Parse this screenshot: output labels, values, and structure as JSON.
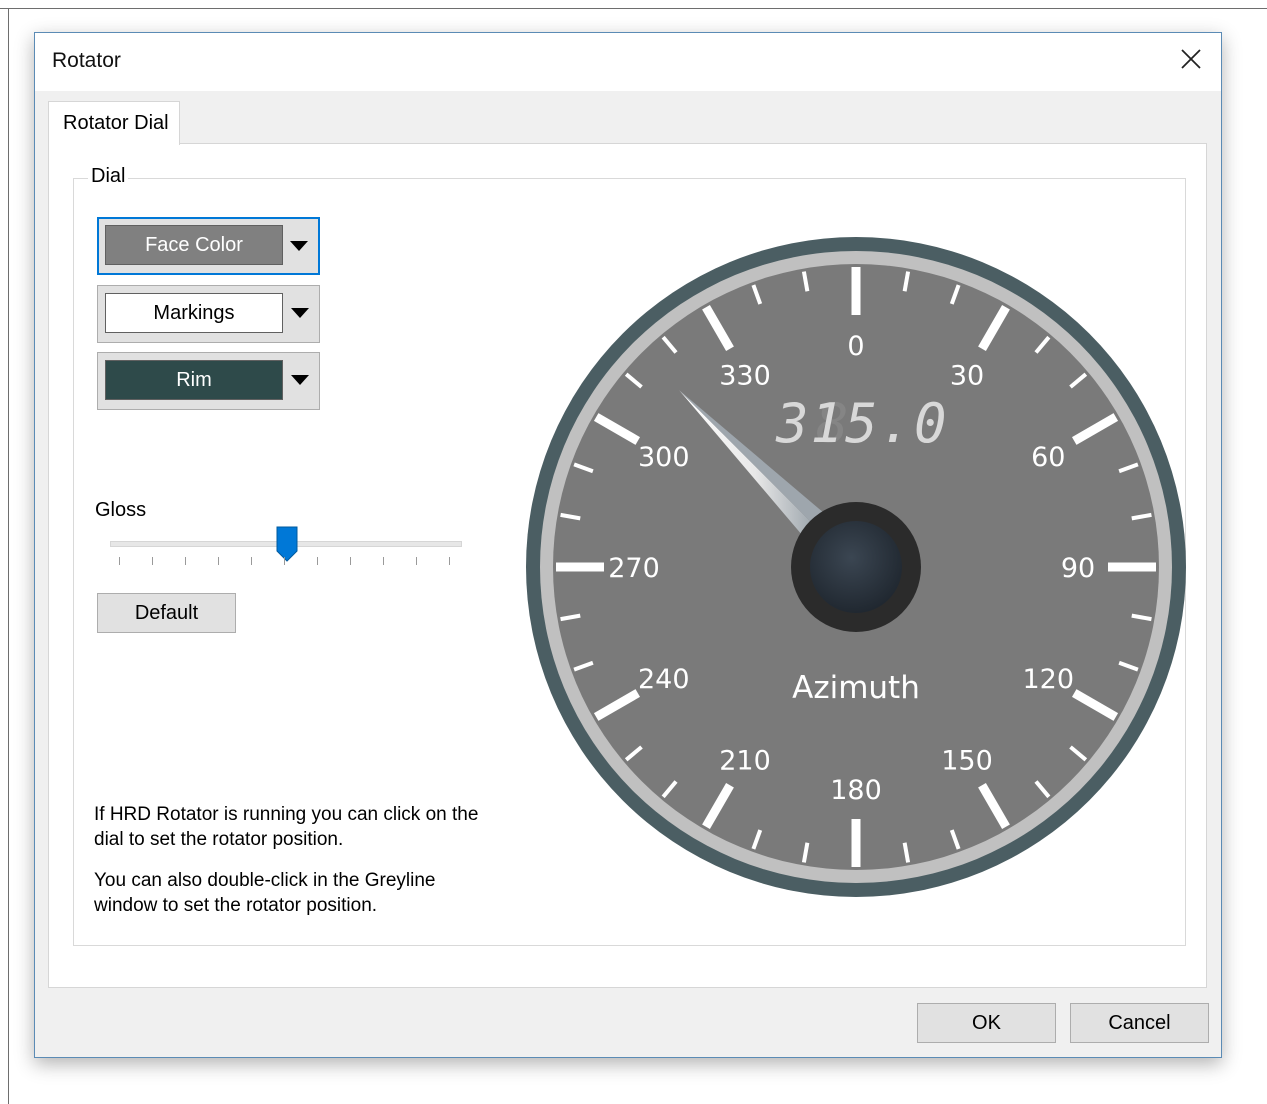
{
  "window": {
    "title": "Rotator",
    "close_icon": "close-icon"
  },
  "tabs": [
    {
      "label": "Rotator Dial",
      "active": true
    }
  ],
  "dial_group": {
    "label": "Dial",
    "face_color": {
      "label": "Face Color",
      "color": "#808080",
      "text_color": "#ffffff"
    },
    "markings": {
      "label": "Markings",
      "color": "#ffffff",
      "text_color": "#000000"
    },
    "rim": {
      "label": "Rim",
      "color": "#2e4a4a",
      "text_color": "#ffffff"
    },
    "gloss": {
      "label": "Gloss",
      "value": 0.5,
      "tick_count": 11
    },
    "default_button": "Default",
    "help_text_1": "If HRD Rotator is running you can click on the dial to set the rotator position.",
    "help_text_2": "You can also double-click in the Greyline window to set the rotator position."
  },
  "dial": {
    "digital_readout": "315.0",
    "digital_ghost": "8",
    "caption": "Azimuth",
    "heading_deg": 315,
    "scale_labels": [
      "0",
      "30",
      "60",
      "90",
      "120",
      "150",
      "180",
      "210",
      "240",
      "270",
      "300",
      "330"
    ],
    "colors": {
      "face": "#7a7a7a",
      "rim": "#4b5e63",
      "ring": "#c0c0c0",
      "markings": "#ffffff",
      "hub": "#222830"
    }
  },
  "footer": {
    "ok_label": "OK",
    "cancel_label": "Cancel"
  }
}
